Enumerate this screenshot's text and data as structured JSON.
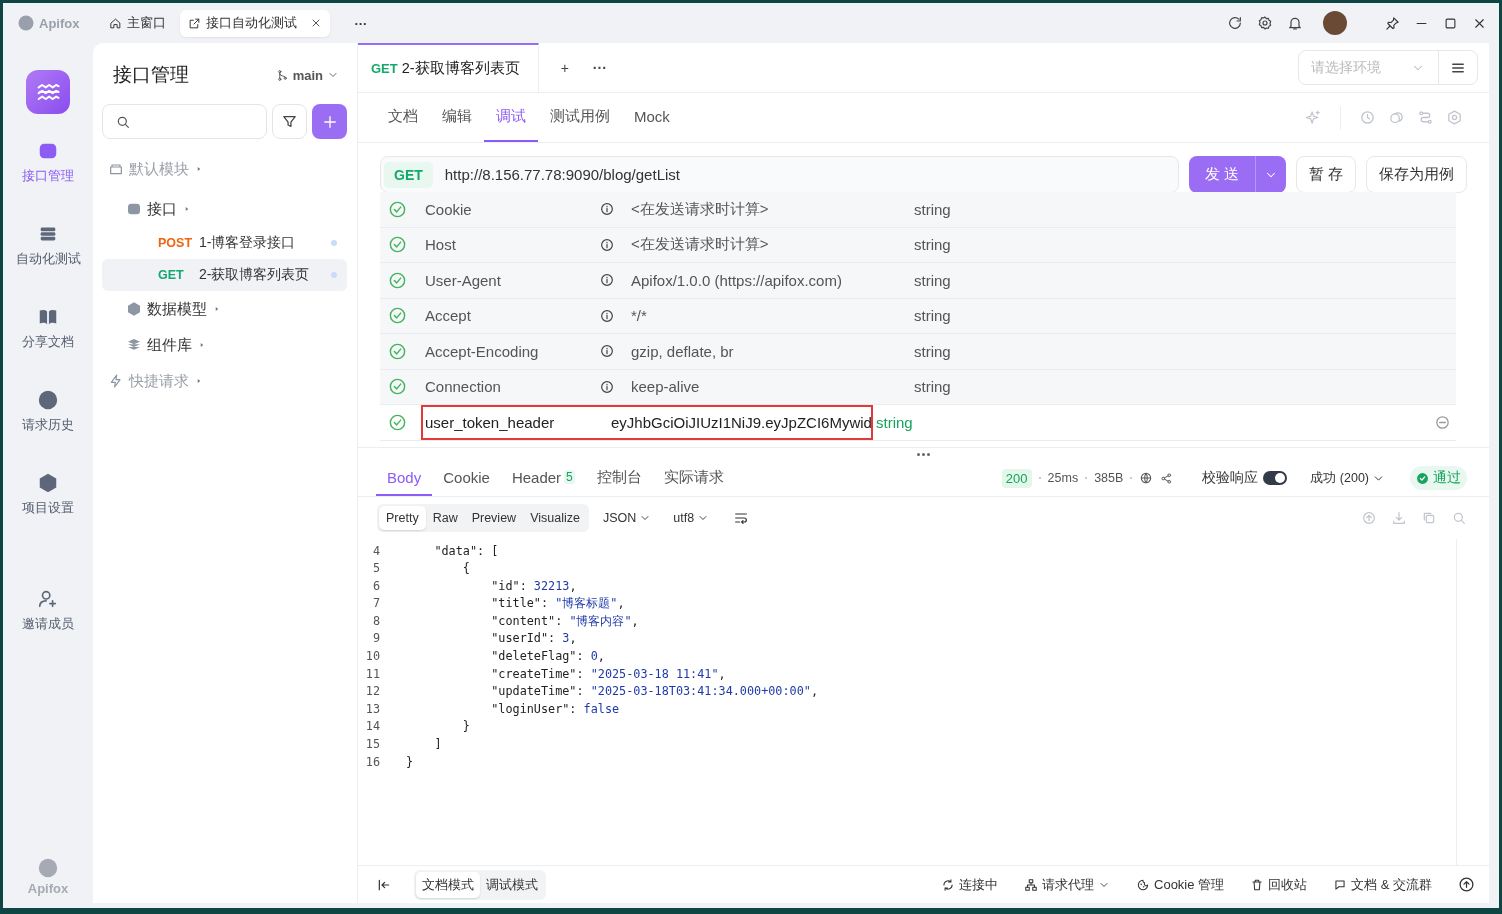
{
  "title_bar": {
    "logo": "Apifox",
    "tabs": [
      {
        "label": "主窗口",
        "selected": false,
        "closable": false
      },
      {
        "label": "接口自动化测试",
        "selected": true,
        "closable": true
      }
    ],
    "more": "···"
  },
  "rail": {
    "items": [
      {
        "label": "接口管理",
        "selected": true
      },
      {
        "label": "自动化测试",
        "selected": false
      },
      {
        "label": "分享文档",
        "selected": false
      },
      {
        "label": "请求历史",
        "selected": false
      },
      {
        "label": "项目设置",
        "selected": false
      },
      {
        "label": "邀请成员",
        "selected": false
      }
    ],
    "footer": "Apifox"
  },
  "sidebar": {
    "title": "接口管理",
    "branch": "main",
    "tree": [
      {
        "label": "默认模块",
        "muted": true,
        "expanded": false,
        "children": [
          {
            "label": "接口",
            "muted": false,
            "expanded": false,
            "children": [
              {
                "method": "POST",
                "label": "1-博客登录接口",
                "selected": false
              },
              {
                "method": "GET",
                "label": "2-获取博客列表页",
                "selected": true
              }
            ]
          },
          {
            "label": "数据模型",
            "muted": false,
            "expanded": false
          },
          {
            "label": "组件库",
            "muted": false,
            "expanded": false
          }
        ]
      },
      {
        "label": "快捷请求",
        "muted": true,
        "expanded": false
      }
    ]
  },
  "editor_tab": {
    "method": "GET",
    "label": "2-获取博客列表页",
    "add": "+",
    "more": "···"
  },
  "environment": {
    "placeholder": "请选择环境"
  },
  "sub_tabs": [
    {
      "label": "文档",
      "selected": false
    },
    {
      "label": "编辑",
      "selected": false
    },
    {
      "label": "调试",
      "selected": true
    },
    {
      "label": "测试用例",
      "selected": false
    },
    {
      "label": "Mock",
      "selected": false
    }
  ],
  "request": {
    "method": "GET",
    "url": "http://8.156.77.78:9090/blog/getList",
    "send": "发 送",
    "save": "暂 存",
    "save_case": "保存为用例"
  },
  "headers": [
    {
      "kind": "auto",
      "checked": true,
      "name": "Cookie",
      "value": "<在发送请求时计算>",
      "type": "string",
      "outlined": false
    },
    {
      "kind": "auto",
      "checked": true,
      "name": "Host",
      "value": "<在发送请求时计算>",
      "type": "string",
      "outlined": false
    },
    {
      "kind": "auto",
      "checked": true,
      "name": "User-Agent",
      "value": "Apifox/1.0.0 (https://apifox.com)",
      "type": "string",
      "outlined": false
    },
    {
      "kind": "auto",
      "checked": true,
      "name": "Accept",
      "value": "*/*",
      "type": "string",
      "outlined": false
    },
    {
      "kind": "auto",
      "checked": true,
      "name": "Accept-Encoding",
      "value": "gzip, deflate, br",
      "type": "string",
      "outlined": false
    },
    {
      "kind": "auto",
      "checked": true,
      "name": "Connection",
      "value": "keep-alive",
      "type": "string",
      "outlined": false
    },
    {
      "kind": "custom",
      "checked": true,
      "name": "user_token_header",
      "value": "eyJhbGciOiJIUzI1NiJ9.eyJpZCI6Mywid",
      "type": "string",
      "outlined": true
    }
  ],
  "response": {
    "tabs": [
      {
        "label": "Body",
        "selected": true
      },
      {
        "label": "Cookie",
        "selected": false
      },
      {
        "label": "Header",
        "badge": "5",
        "selected": false
      },
      {
        "label": "控制台",
        "selected": false
      },
      {
        "label": "实际请求",
        "selected": false
      }
    ],
    "status": "200",
    "time": "25ms",
    "size": "385B",
    "validate_label": "校验响应",
    "validate_on": true,
    "expect": "成功 (200)",
    "result": "通过",
    "formats": [
      {
        "label": "Pretty",
        "selected": true
      },
      {
        "label": "Raw",
        "selected": false
      },
      {
        "label": "Preview",
        "selected": false
      },
      {
        "label": "Visualize",
        "selected": false
      }
    ],
    "language": "JSON",
    "encoding": "utf8",
    "lines": [
      {
        "number": "4",
        "tokens": [
          {
            "kind": "key",
            "text": "    \"data\""
          },
          {
            "kind": "punct",
            "text": ": ["
          }
        ]
      },
      {
        "number": "5",
        "tokens": [
          {
            "kind": "punct",
            "text": "        {"
          }
        ]
      },
      {
        "number": "6",
        "tokens": [
          {
            "kind": "key",
            "text": "            \"id\""
          },
          {
            "kind": "punct",
            "text": ": "
          },
          {
            "kind": "value",
            "text": "32213"
          },
          {
            "kind": "punct",
            "text": ","
          }
        ]
      },
      {
        "number": "7",
        "tokens": [
          {
            "kind": "key",
            "text": "            \"title\""
          },
          {
            "kind": "punct",
            "text": ": "
          },
          {
            "kind": "value",
            "text": "\"博客标题\""
          },
          {
            "kind": "punct",
            "text": ","
          }
        ]
      },
      {
        "number": "8",
        "tokens": [
          {
            "kind": "key",
            "text": "            \"content\""
          },
          {
            "kind": "punct",
            "text": ": "
          },
          {
            "kind": "value",
            "text": "\"博客内容\""
          },
          {
            "kind": "punct",
            "text": ","
          }
        ]
      },
      {
        "number": "9",
        "tokens": [
          {
            "kind": "key",
            "text": "            \"userId\""
          },
          {
            "kind": "punct",
            "text": ": "
          },
          {
            "kind": "value",
            "text": "3"
          },
          {
            "kind": "punct",
            "text": ","
          }
        ]
      },
      {
        "number": "10",
        "tokens": [
          {
            "kind": "key",
            "text": "            \"deleteFlag\""
          },
          {
            "kind": "punct",
            "text": ": "
          },
          {
            "kind": "value",
            "text": "0"
          },
          {
            "kind": "punct",
            "text": ","
          }
        ]
      },
      {
        "number": "11",
        "tokens": [
          {
            "kind": "key",
            "text": "            \"createTime\""
          },
          {
            "kind": "punct",
            "text": ": "
          },
          {
            "kind": "value",
            "text": "\"2025-03-18 11:41\""
          },
          {
            "kind": "punct",
            "text": ","
          }
        ]
      },
      {
        "number": "12",
        "tokens": [
          {
            "kind": "key",
            "text": "            \"updateTime\""
          },
          {
            "kind": "punct",
            "text": ": "
          },
          {
            "kind": "value",
            "text": "\"2025-03-18T03:41:34.000+00:00\""
          },
          {
            "kind": "punct",
            "text": ","
          }
        ]
      },
      {
        "number": "13",
        "tokens": [
          {
            "kind": "key",
            "text": "            \"loginUser\""
          },
          {
            "kind": "punct",
            "text": ": "
          },
          {
            "kind": "value",
            "text": "false"
          }
        ]
      },
      {
        "number": "14",
        "tokens": [
          {
            "kind": "punct",
            "text": "        }"
          }
        ]
      },
      {
        "number": "15",
        "tokens": [
          {
            "kind": "punct",
            "text": "    ]"
          }
        ]
      },
      {
        "number": "16",
        "tokens": [
          {
            "kind": "punct",
            "text": "}"
          }
        ]
      }
    ]
  },
  "status_bar": {
    "modes": [
      {
        "label": "文档模式",
        "selected": true
      },
      {
        "label": "调试模式",
        "selected": false
      }
    ],
    "items": [
      "连接中",
      "请求代理",
      "Cookie 管理",
      "回收站",
      "文档 & 交流群"
    ]
  }
}
